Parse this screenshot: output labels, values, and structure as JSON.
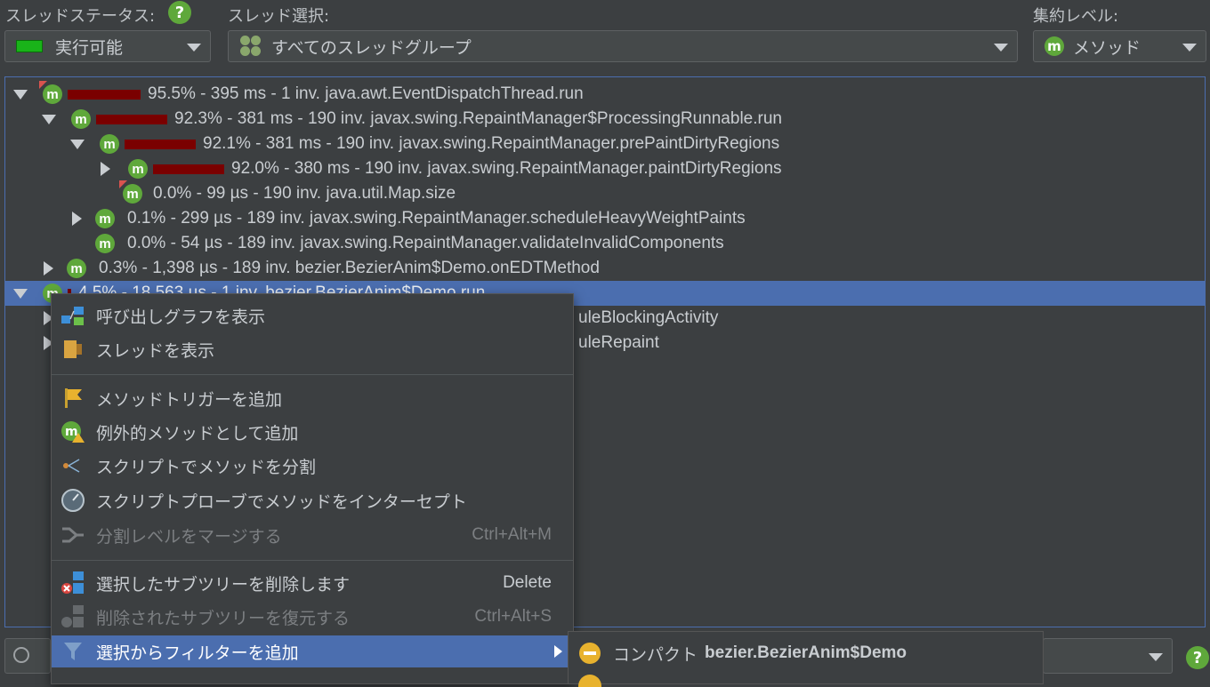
{
  "toolbar": {
    "thread_status_label": "スレッドステータス:",
    "thread_status_value": "実行可能",
    "thread_select_label": "スレッド選択:",
    "thread_select_value": "すべてのスレッドグループ",
    "aggregation_label": "集約レベル:",
    "aggregation_value": "メソッド",
    "help_glyph": "?",
    "method_glyph": "m"
  },
  "tree": {
    "rows": [
      {
        "text": "95.5% - 395 ms - 1 inv. java.awt.EventDispatchThread.run",
        "bar_fraction": 0.955
      },
      {
        "text": "92.3% - 381 ms - 190 inv. javax.swing.RepaintManager$ProcessingRunnable.run",
        "bar_fraction": 0.923
      },
      {
        "text": "92.1% - 381 ms - 190 inv. javax.swing.RepaintManager.prePaintDirtyRegions",
        "bar_fraction": 0.921
      },
      {
        "text": "92.0% - 380 ms - 190 inv. javax.swing.RepaintManager.paintDirtyRegions",
        "bar_fraction": 0.92
      },
      {
        "text": "0.0% - 99 µs - 190 inv. java.util.Map.size",
        "bar_fraction": 0
      },
      {
        "text": "0.1% - 299 µs - 189 inv. javax.swing.RepaintManager.scheduleHeavyWeightPaints",
        "bar_fraction": 0.001
      },
      {
        "text": "0.0% - 54 µs - 189 inv. javax.swing.RepaintManager.validateInvalidComponents",
        "bar_fraction": 0
      },
      {
        "text": "0.3% - 1,398 µs - 189 inv. bezier.BezierAnim$Demo.onEDTMethod",
        "bar_fraction": 0.003
      },
      {
        "text": "4.5% - 18,563 µs - 1 inv. bezier.BezierAnim$Demo.run",
        "bar_fraction": 0.045
      },
      {
        "text": "uleBlockingActivity",
        "bar_fraction": 0
      },
      {
        "text": "uleRepaint",
        "bar_fraction": 0
      }
    ]
  },
  "context_menu": {
    "items": [
      {
        "label": "呼び出しグラフを表示",
        "shortcut": ""
      },
      {
        "label": "スレッドを表示",
        "shortcut": ""
      },
      {
        "label": "メソッドトリガーを追加",
        "shortcut": ""
      },
      {
        "label": "例外的メソッドとして追加",
        "shortcut": ""
      },
      {
        "label": "スクリプトでメソッドを分割",
        "shortcut": ""
      },
      {
        "label": "スクリプトプローブでメソッドをインターセプト",
        "shortcut": ""
      },
      {
        "label": "分割レベルをマージする",
        "shortcut": "Ctrl+Alt+M"
      },
      {
        "label": "選択したサブツリーを削除します",
        "shortcut": "Delete"
      },
      {
        "label": "削除されたサブツリーを復元する",
        "shortcut": "Ctrl+Alt+S"
      },
      {
        "label": "選択からフィルターを追加",
        "shortcut": ""
      }
    ]
  },
  "submenu": {
    "item_prefix": "コンパクト",
    "item_bold": "bezier.BezierAnim$Demo"
  },
  "colors": {
    "background": "#3c3f41",
    "selection": "#4b6eaf",
    "method_icon": "#5fa83b",
    "time_bar": "#7a0000"
  }
}
